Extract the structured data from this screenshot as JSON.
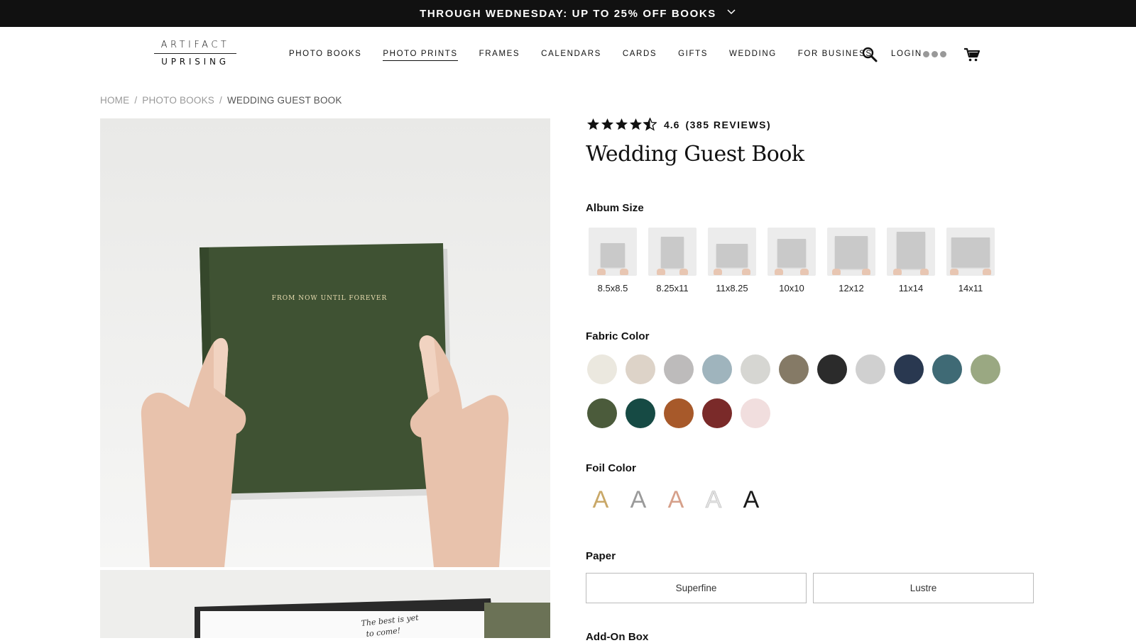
{
  "promo": {
    "text": "THROUGH WEDNESDAY: UP TO 25% OFF BOOKS",
    "chevron_icon": "chevron-down-icon"
  },
  "header": {
    "logo": {
      "line1": "ARTIFACT",
      "line2": "UPRISING"
    },
    "nav": [
      "PHOTO BOOKS",
      "PHOTO PRINTS",
      "FRAMES",
      "CALENDARS",
      "CARDS",
      "GIFTS",
      "WEDDING",
      "FOR BUSINESS"
    ],
    "search_icon": "search-icon",
    "login_label": "LOGIN",
    "cart_icon": "cart-icon"
  },
  "breadcrumb": {
    "home": "HOME",
    "sep": "/",
    "category": "PHOTO BOOKS",
    "current": "WEDDING GUEST BOOK"
  },
  "gallery": {
    "hero_cover_text": "FROM NOW UNTIL FOREVER",
    "hero_cover_color": "#3f5233",
    "second_page_text_line1": "The best is yet",
    "second_page_text_line2": "to come!"
  },
  "product": {
    "rating": {
      "stars": 4.6,
      "value": "4.6",
      "reviews": "(385 REVIEWS)"
    },
    "title": "Wedding Guest Book",
    "album_size": {
      "label": "Album Size",
      "options": [
        "8.5x8.5",
        "8.25x11",
        "11x8.25",
        "10x10",
        "12x12",
        "11x14",
        "14x11"
      ]
    },
    "fabric_color": {
      "label": "Fabric Color",
      "row1": [
        "#ebe8df",
        "#ddd3c8",
        "#bdbbbb",
        "#9fb4bd",
        "#d6d6d2",
        "#857a66",
        "#2b2b2b",
        "#d0d0d0",
        "#293850",
        "#3f6a75",
        "#9aa882"
      ],
      "row2": [
        "#4b5b3b",
        "#164a44",
        "#a7592a",
        "#7a2a29",
        "#f1dede"
      ]
    },
    "foil_color": {
      "label": "Foil Color",
      "glyph": "A",
      "options": [
        {
          "name": "gold",
          "color": "#c9a868"
        },
        {
          "name": "silver",
          "color": "#9a9a9a"
        },
        {
          "name": "rose-gold",
          "color": "#d6a08a"
        },
        {
          "name": "white",
          "color": "#e3e3e3"
        },
        {
          "name": "black",
          "color": "#1a1a1a"
        }
      ]
    },
    "paper": {
      "label": "Paper",
      "options": [
        "Superfine",
        "Lustre"
      ]
    },
    "add_on": {
      "label": "Add-On Box"
    }
  }
}
